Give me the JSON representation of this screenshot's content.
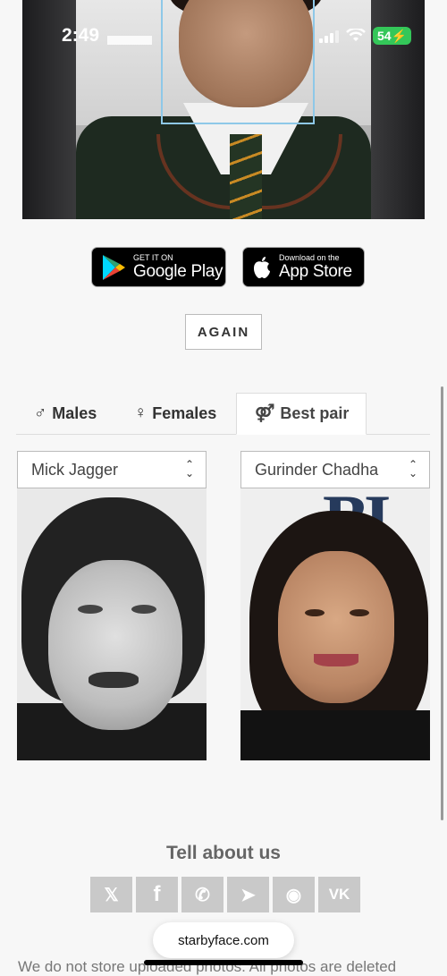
{
  "status_bar": {
    "time": "2:49",
    "battery": "54"
  },
  "stores": {
    "google": {
      "small": "GET IT ON",
      "big": "Google Play"
    },
    "apple": {
      "small": "Download on the",
      "big": "App Store"
    }
  },
  "again_label": "AGAIN",
  "tabs": [
    {
      "symbol": "♂",
      "label": "Males",
      "active": false
    },
    {
      "symbol": "♀",
      "label": "Females",
      "active": false
    },
    {
      "symbol": "⚤",
      "label": "Best pair",
      "active": true
    }
  ],
  "selects": {
    "left": {
      "value": "Mick Jagger"
    },
    "right": {
      "value": "Gurinder Chadha"
    }
  },
  "share": {
    "title": "Tell about us",
    "buttons": [
      {
        "icon": "x-icon",
        "glyph": "𝕏"
      },
      {
        "icon": "facebook-icon",
        "glyph": "f"
      },
      {
        "icon": "whatsapp-icon",
        "glyph": "✆"
      },
      {
        "icon": "telegram-icon",
        "glyph": "➤"
      },
      {
        "icon": "reddit-icon",
        "glyph": "◉"
      },
      {
        "icon": "vk-icon",
        "glyph": "VK"
      }
    ]
  },
  "browser": {
    "url": "starbyface.com"
  },
  "footer": {
    "text": "We do not store uploaded photos. All photos are deleted"
  }
}
